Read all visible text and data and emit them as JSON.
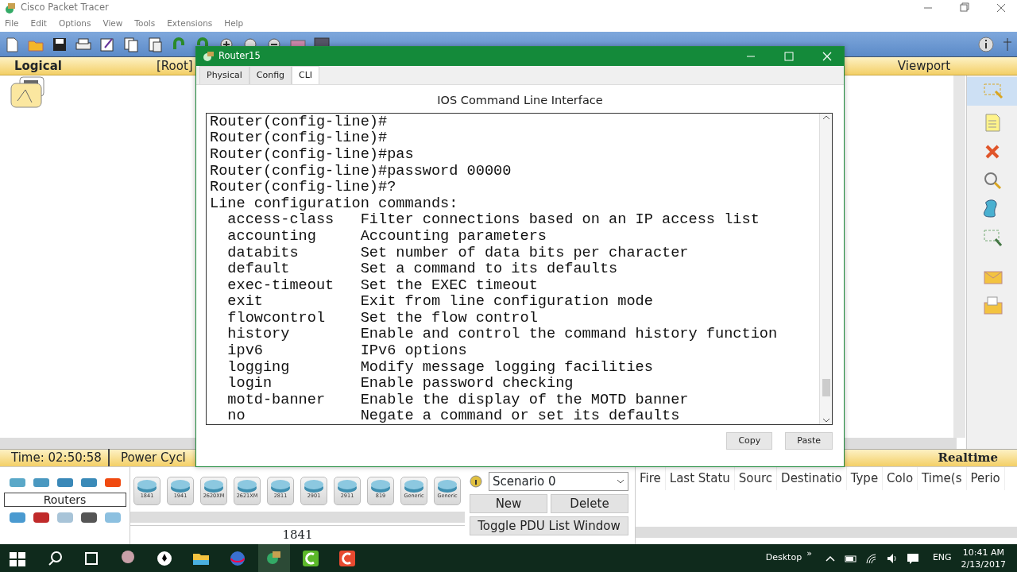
{
  "app": {
    "title": "Cisco Packet Tracer",
    "menu": [
      "File",
      "Edit",
      "Options",
      "View",
      "Tools",
      "Extensions",
      "Help"
    ]
  },
  "workspace_bar": {
    "tab": "Logical",
    "path": "[Root]",
    "viewport": "Viewport"
  },
  "status_bar": {
    "time": "Time: 02:50:58",
    "power_cycle": "Power Cycl",
    "mode": "Realtime"
  },
  "device_panel": {
    "category": "Routers",
    "devices": [
      "1841",
      "1941",
      "2620XM",
      "2621XM",
      "2811",
      "2901",
      "2911",
      "819",
      "Generic",
      "Generic"
    ],
    "model_name": "1841"
  },
  "scenario": {
    "value": "Scenario 0",
    "buttons": [
      "New",
      "Delete"
    ],
    "toggle": "Toggle PDU List Window"
  },
  "pdu_table": {
    "columns": [
      "Fire",
      "Last Statu",
      "Sourc",
      "Destinatio",
      "Type",
      "Colo",
      "Time(s",
      "Perio"
    ]
  },
  "dialog": {
    "title": "Router15",
    "tabs": [
      {
        "label": "Physical",
        "selected": false
      },
      {
        "label": "Config",
        "selected": false
      },
      {
        "label": "CLI",
        "selected": true
      }
    ],
    "heading": "IOS Command Line Interface",
    "lines": [
      {
        "kind": "prompt",
        "text": "Router(config-line)#"
      },
      {
        "kind": "prompt",
        "text": "Router(config-line)#"
      },
      {
        "kind": "prompt",
        "text": "Router(config-line)#pas"
      },
      {
        "kind": "prompt",
        "text": "Router(config-line)#password 00000"
      },
      {
        "kind": "prompt",
        "text": "Router(config-line)#?"
      },
      {
        "kind": "prompt",
        "text": "Line configuration commands:"
      },
      {
        "kind": "help",
        "command": "access-class",
        "description": "Filter connections based on an IP access list"
      },
      {
        "kind": "help",
        "command": "accounting",
        "description": "Accounting parameters"
      },
      {
        "kind": "help",
        "command": "databits",
        "description": "Set number of data bits per character"
      },
      {
        "kind": "help",
        "command": "default",
        "description": "Set a command to its defaults"
      },
      {
        "kind": "help",
        "command": "exec-timeout",
        "description": "Set the EXEC timeout"
      },
      {
        "kind": "help",
        "command": "exit",
        "description": "Exit from line configuration mode"
      },
      {
        "kind": "help",
        "command": "flowcontrol",
        "description": "Set the flow control"
      },
      {
        "kind": "help",
        "command": "history",
        "description": "Enable and control the command history function"
      },
      {
        "kind": "help",
        "command": "ipv6",
        "description": "IPv6 options"
      },
      {
        "kind": "help",
        "command": "logging",
        "description": "Modify message logging facilities"
      },
      {
        "kind": "help",
        "command": "login",
        "description": "Enable password checking"
      },
      {
        "kind": "help",
        "command": "motd-banner",
        "description": "Enable the display of the MOTD banner"
      },
      {
        "kind": "help",
        "command": "no",
        "description": "Negate a command or set its defaults"
      }
    ],
    "buttons": [
      "Copy",
      "Paste"
    ]
  },
  "taskbar": {
    "desktop": "Desktop",
    "chevron": "»",
    "language": "ENG",
    "time": "10:41 AM",
    "date": "2/13/2017"
  }
}
